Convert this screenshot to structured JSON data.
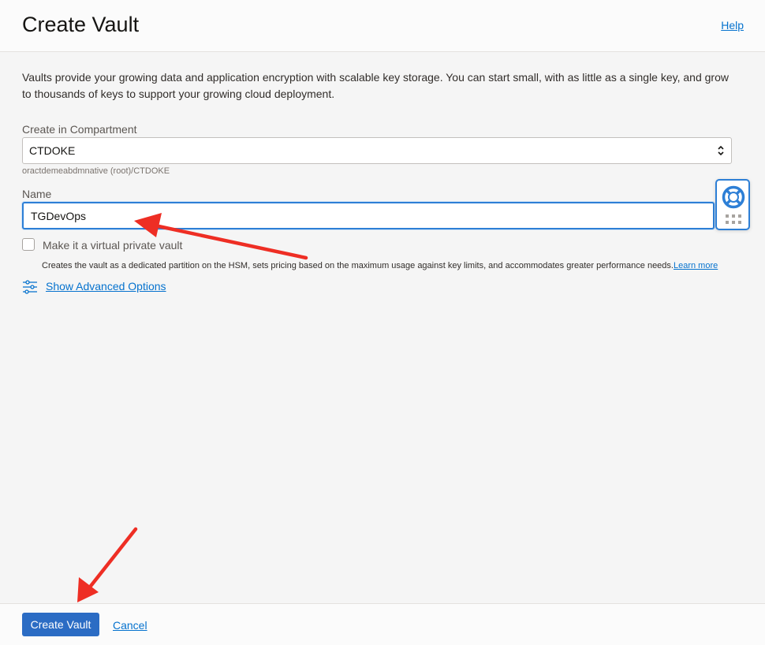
{
  "header": {
    "title": "Create Vault",
    "help_label": "Help"
  },
  "intro": {
    "text": "Vaults provide your growing data and application encryption with scalable key storage. You can start small, with as little as a single key, and grow to thousands of keys to support your growing cloud deployment."
  },
  "compartment": {
    "label": "Create in Compartment",
    "value": "CTDOKE",
    "path_hint": "oractdemeabdmnative (root)/CTDOKE"
  },
  "name_field": {
    "label": "Name",
    "value": "TGDevOps"
  },
  "virtual_private": {
    "label": "Make it a virtual private vault",
    "checked": false,
    "description": "Creates the vault as a dedicated partition on the HSM, sets pricing based on the maximum usage against key limits, and accommodates greater performance needs.",
    "learn_more": "Learn more"
  },
  "advanced": {
    "label": "Show Advanced Options",
    "icon": "sliders-icon"
  },
  "help_widget": {
    "icon": "lifebuoy-icon",
    "grip_icon": "grip-dots-icon"
  },
  "footer": {
    "create_label": "Create Vault",
    "cancel_label": "Cancel"
  },
  "colors": {
    "accent": "#0572ce",
    "primary_button": "#2b6cc4",
    "annotation_arrow": "#ee2e24"
  }
}
